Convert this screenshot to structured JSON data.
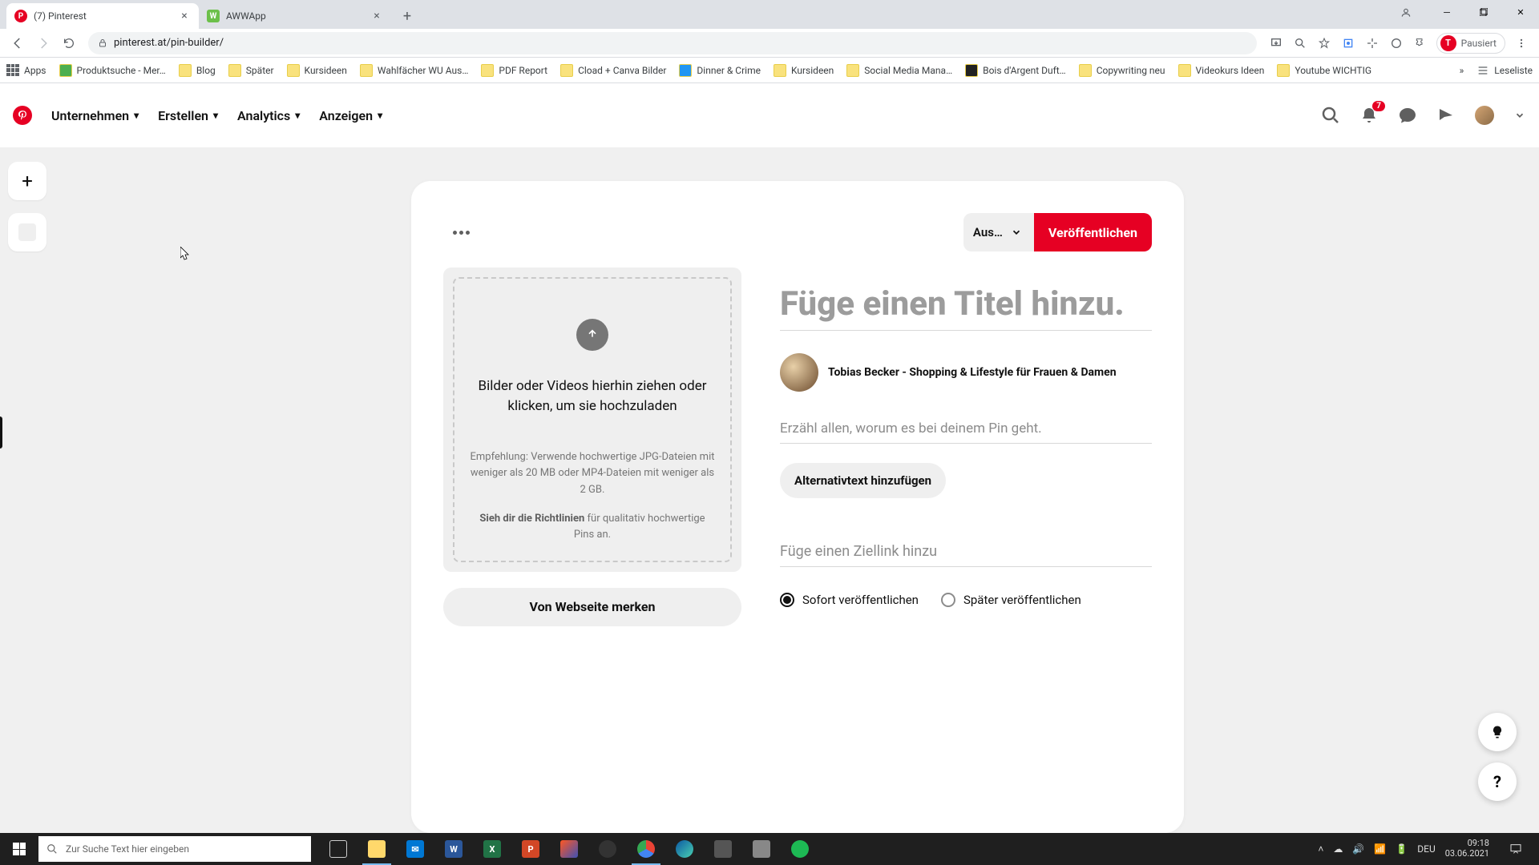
{
  "browser": {
    "tabs": [
      {
        "title": "(7) Pinterest",
        "favicon": "pinterest",
        "active": true
      },
      {
        "title": "AWWApp",
        "favicon": "awwapp",
        "active": false
      }
    ],
    "url": "pinterest.at/pin-builder/",
    "profile_status": "Pausiert",
    "profile_initial": "T",
    "bookmarks": {
      "apps": "Apps",
      "items": [
        "Produktsuche - Mer…",
        "Blog",
        "Später",
        "Kursideen",
        "Wahlfächer WU Aus…",
        "PDF Report",
        "Cload + Canva Bilder",
        "Dinner & Crime",
        "Kursideen",
        "Social Media Mana…",
        "Bois d'Argent Duft…",
        "Copywriting neu",
        "Videokurs Ideen",
        "Youtube WICHTIG"
      ],
      "reading_list": "Leseliste"
    }
  },
  "pinterest": {
    "nav": {
      "business": "Unternehmen",
      "create": "Erstellen",
      "analytics": "Analytics",
      "ads": "Anzeigen"
    },
    "notifications_count": "7",
    "builder": {
      "board_selector": "Aus…",
      "publish_button": "Veröffentlichen",
      "upload": {
        "main_text": "Bilder oder Videos hierhin ziehen oder klicken, um sie hochzuladen",
        "hint": "Empfehlung: Verwende hochwertige JPG-Dateien mit weniger als 20 MB oder MP4-Dateien mit weniger als 2 GB.",
        "guidelines_bold": "Sieh dir die Richtlinien",
        "guidelines_rest": " für qualitativ hochwertige Pins an."
      },
      "save_from_web": "Von Webseite merken",
      "title_placeholder": "Füge einen Titel hinzu.",
      "author": "Tobias Becker - Shopping & Lifestyle für Frauen & Damen",
      "description_placeholder": "Erzähl allen, worum es bei deinem Pin geht.",
      "alt_text_button": "Alternativtext hinzufügen",
      "link_placeholder": "Füge einen Ziellink hinzu",
      "publish_now": "Sofort veröffentlichen",
      "publish_later": "Später veröffentlichen"
    }
  },
  "taskbar": {
    "search_placeholder": "Zur Suche Text hier eingeben",
    "language": "DEU",
    "time": "09:18",
    "date": "03.06.2021"
  }
}
